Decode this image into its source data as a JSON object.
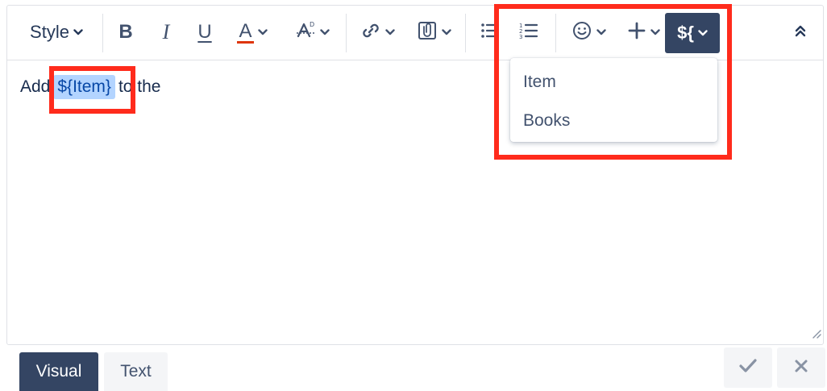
{
  "toolbar": {
    "style_label": "Style",
    "bold_label": "B",
    "italic_label": "I",
    "underline_label": "U",
    "text_color_label": "A",
    "text_color_accent": "#de350b",
    "variable_label": "${",
    "icons": {
      "format": "text-format-icon",
      "link": "link-icon",
      "attachment": "attachment-icon",
      "bullet_list": "bullet-list-icon",
      "numbered_list": "numbered-list-icon",
      "emoji": "emoji-icon",
      "insert": "plus-icon",
      "collapse": "double-chevron-up-icon",
      "dropdown": "chevron-down-icon"
    }
  },
  "content": {
    "before": "Add",
    "placeholder": "${Item}",
    "after": "to the"
  },
  "variable_menu": {
    "items": [
      {
        "label": "Item"
      },
      {
        "label": "Books"
      }
    ]
  },
  "tabs": {
    "visual": "Visual",
    "text": "Text"
  },
  "actions": {
    "confirm_icon": "checkmark-icon",
    "cancel_icon": "close-icon"
  },
  "colors": {
    "primary_dark": "#344563",
    "text": "#172b4d",
    "highlight_annotation": "#ff2b1c",
    "placeholder_bg": "#b3d4ff",
    "subtle_bg": "#f4f5f7"
  }
}
